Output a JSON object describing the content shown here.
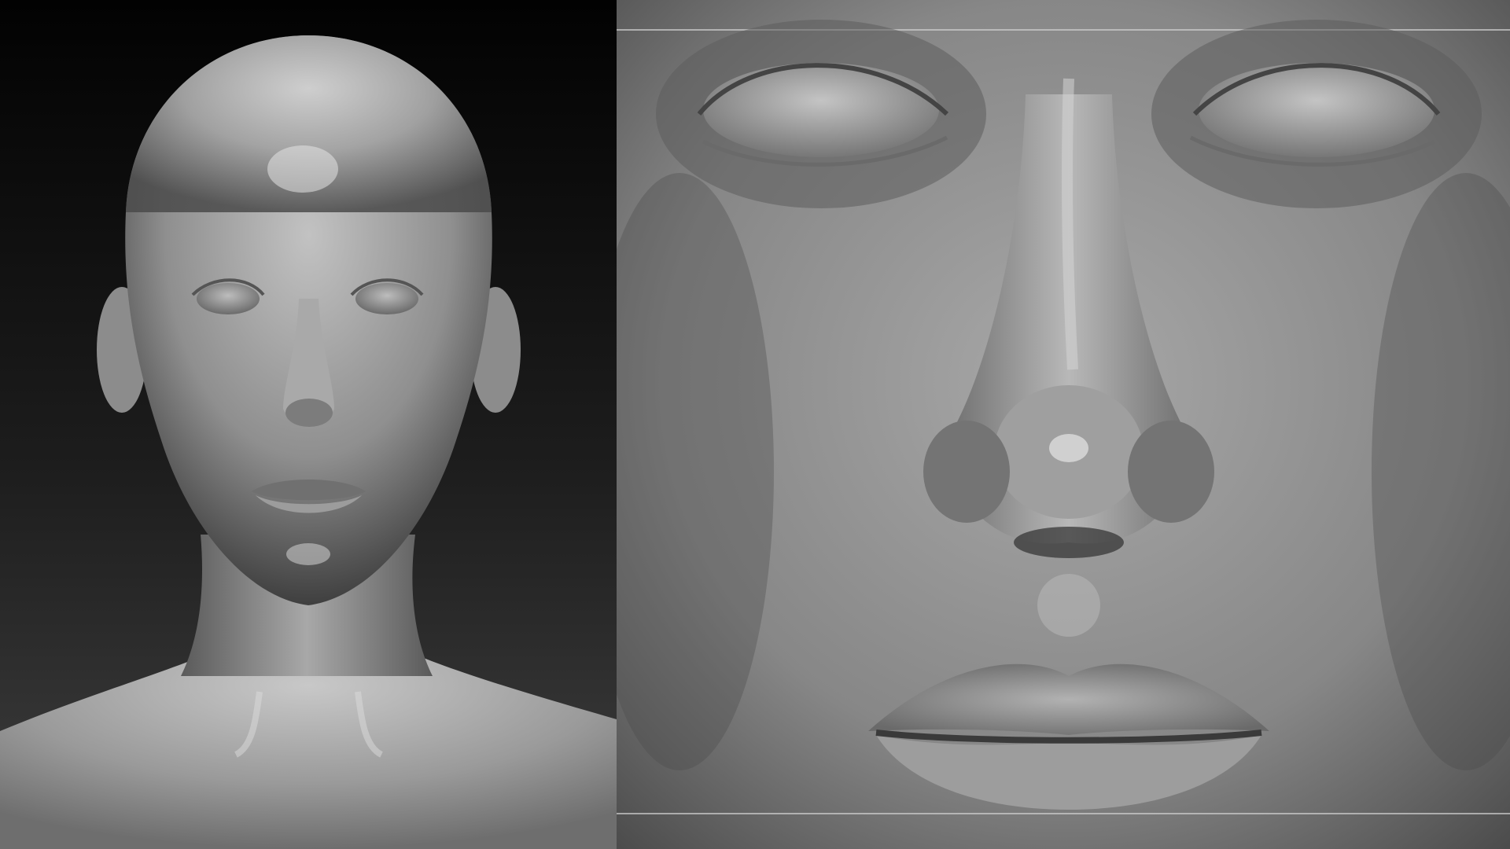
{
  "image": {
    "description_visible_text": "",
    "panels": [
      {
        "id": "full-bust-front-view"
      },
      {
        "id": "face-closeup-view"
      }
    ]
  },
  "colors": {
    "background_top": "#050505",
    "background_bottom": "#3a3a3a",
    "clay_light": "#c9c9c9",
    "clay_mid": "#8a8a8a",
    "clay_dark": "#3c3c3c"
  }
}
